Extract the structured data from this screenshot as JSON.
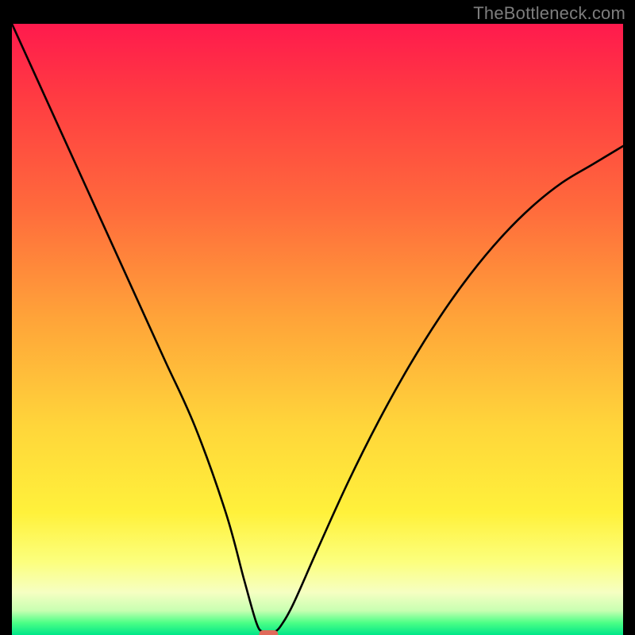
{
  "watermark": "TheBottleneck.com",
  "chart_data": {
    "type": "line",
    "title": "",
    "xlabel": "",
    "ylabel": "",
    "xlim": [
      0,
      100
    ],
    "ylim": [
      0,
      100
    ],
    "grid": false,
    "series": [
      {
        "name": "curve",
        "x": [
          0,
          5,
          10,
          15,
          20,
          25,
          30,
          35,
          38,
          40,
          41,
          42,
          43,
          44,
          46,
          50,
          55,
          60,
          65,
          70,
          75,
          80,
          85,
          90,
          95,
          100
        ],
        "values": [
          100,
          89,
          78,
          67,
          56,
          45,
          34,
          20,
          9,
          2,
          0.5,
          0,
          0.5,
          1.5,
          5,
          14,
          25,
          35,
          44,
          52,
          59,
          65,
          70,
          74,
          77,
          80
        ]
      }
    ],
    "annotations": [
      {
        "type": "marker",
        "shape": "pill",
        "x": 42,
        "y": 0,
        "color": "#e06a5a"
      }
    ]
  }
}
